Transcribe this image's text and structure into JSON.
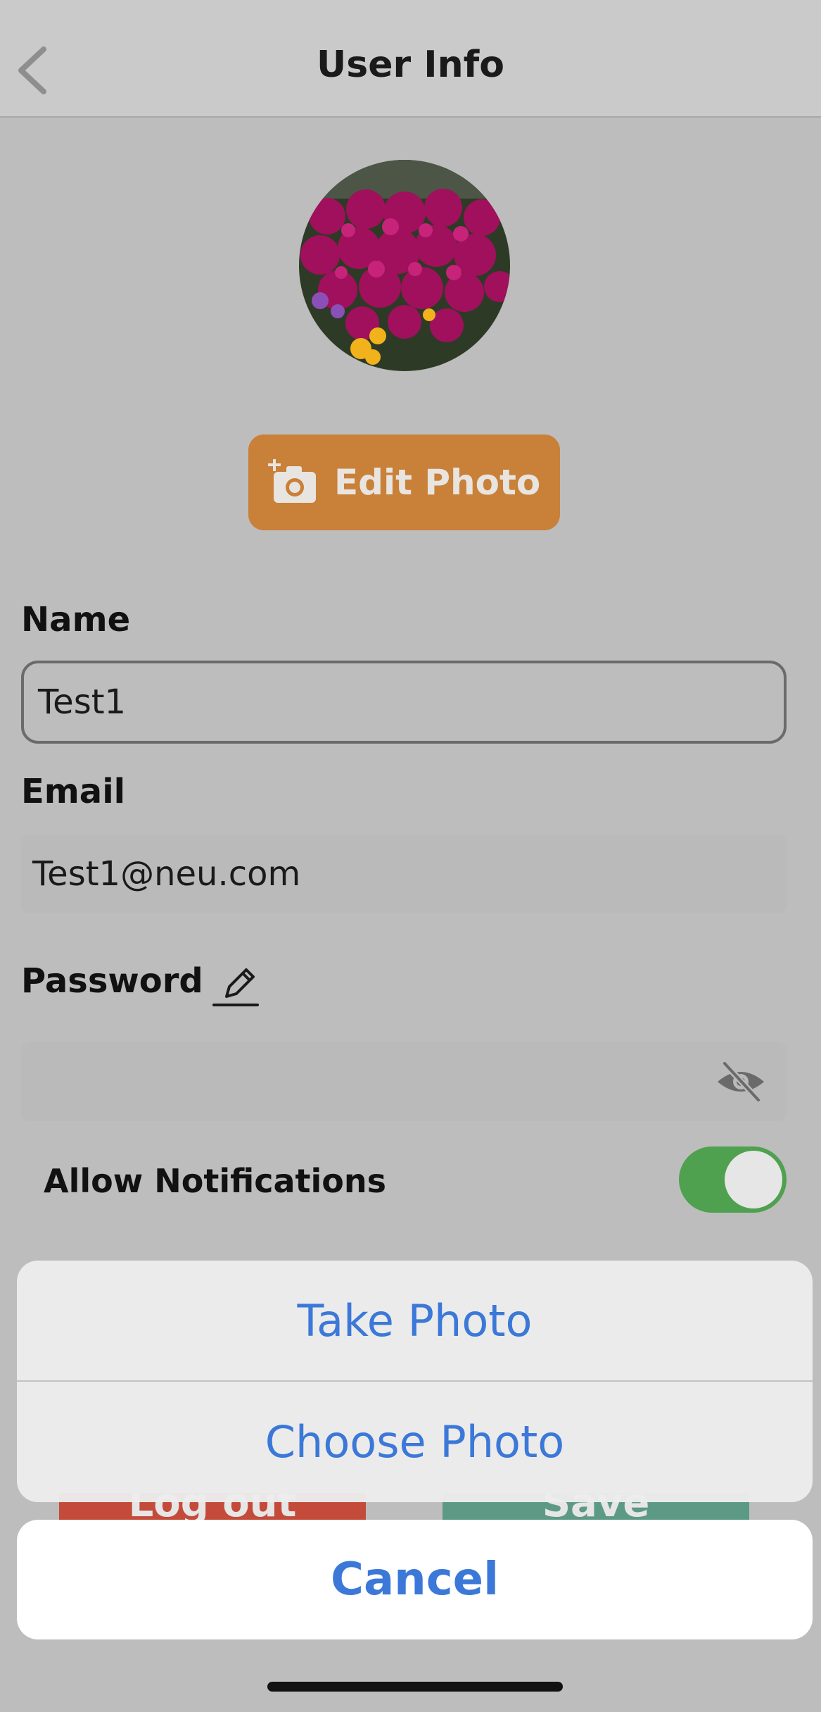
{
  "header": {
    "title": "User Info"
  },
  "profile": {
    "edit_photo_label": "Edit Photo"
  },
  "form": {
    "name_label": "Name",
    "name_value": "Test1",
    "email_label": "Email",
    "email_value": "Test1@neu.com",
    "password_label": "Password",
    "notifications_label": "Allow Notifications",
    "notifications_enabled": true
  },
  "background_buttons": {
    "logout_label": "Log out",
    "save_label": "Save"
  },
  "action_sheet": {
    "take_photo": "Take Photo",
    "choose_photo": "Choose Photo",
    "cancel": "Cancel"
  },
  "colors": {
    "accent_orange": "#c98038",
    "toggle_green": "#4fa14f",
    "ios_blue": "#3b78d8",
    "logout_red": "#c44b3a",
    "save_green": "#5d9a86"
  },
  "icons": {
    "back": "chevron-left-icon",
    "camera": "camera-plus-icon",
    "edit": "pencil-icon",
    "visibility": "eye-slash-icon"
  }
}
